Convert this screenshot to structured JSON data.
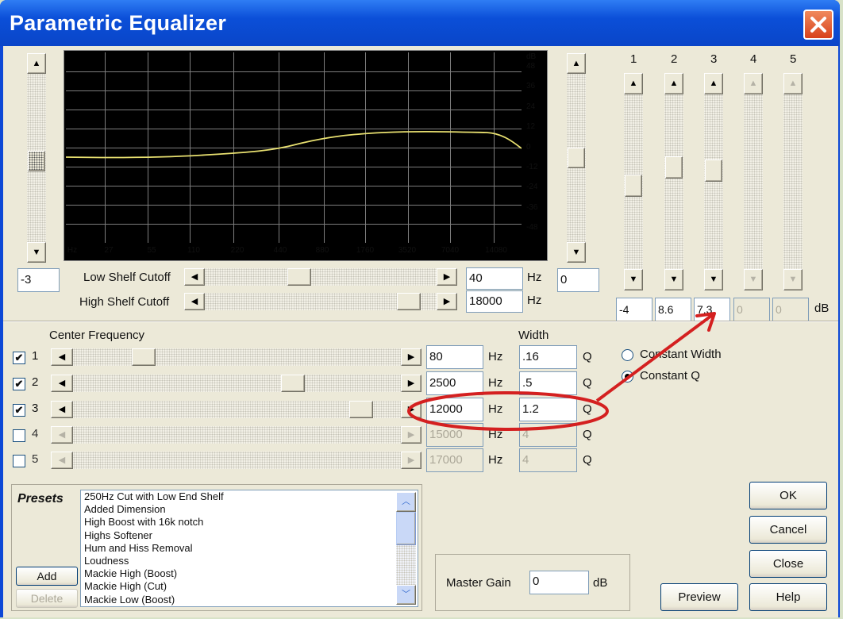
{
  "window": {
    "title": "Parametric Equalizer"
  },
  "graph": {
    "x_ticks": [
      "Hz",
      "27",
      "55",
      "110",
      "220",
      "440",
      "880",
      "1760",
      "3520",
      "7040",
      "14080"
    ],
    "y_unit": "dB",
    "y_ticks": [
      "48",
      "36",
      "24",
      "12",
      "0",
      "-12",
      "-24",
      "-36",
      "-48"
    ],
    "curve_color": "#e8e070"
  },
  "left_gain": {
    "value": "-3"
  },
  "right_gain": {
    "value": "0"
  },
  "shelf": {
    "low_label": "Low Shelf Cutoff",
    "low_value": "40",
    "high_label": "High Shelf Cutoff",
    "high_value": "18000",
    "unit": "Hz"
  },
  "bands": {
    "headers": [
      "1",
      "2",
      "3",
      "4",
      "5"
    ],
    "gains": [
      "-4",
      "8.6",
      "7.3",
      "0",
      "0"
    ],
    "gain_unit": "dB"
  },
  "center": {
    "label": "Center Frequency",
    "width_label": "Width",
    "hz": "Hz",
    "q": "Q",
    "rows": [
      {
        "num": "1",
        "checked": "✔",
        "freq": "80",
        "width": ".16"
      },
      {
        "num": "2",
        "checked": "✔",
        "freq": "2500",
        "width": ".5"
      },
      {
        "num": "3",
        "checked": "✔",
        "freq": "12000",
        "width": "1.2"
      },
      {
        "num": "4",
        "checked": "",
        "freq": "15000",
        "width": "4"
      },
      {
        "num": "5",
        "checked": "",
        "freq": "17000",
        "width": "4"
      }
    ]
  },
  "mode": {
    "constant_width": "Constant Width",
    "constant_q": "Constant Q",
    "selected": "Constant Q"
  },
  "presets": {
    "label": "Presets",
    "items": [
      "250Hz Cut with Low End Shelf",
      "Added Dimension",
      "High Boost with 16k notch",
      "Highs Softener",
      "Hum and Hiss Removal",
      "Loudness",
      "Mackie High (Boost)",
      "Mackie High (Cut)",
      "Mackie Low (Boost)"
    ],
    "add": "Add",
    "delete": "Delete"
  },
  "master_gain": {
    "label": "Master Gain",
    "value": "0",
    "unit": "dB"
  },
  "buttons": {
    "ok": "OK",
    "cancel": "Cancel",
    "close": "Close",
    "preview": "Preview",
    "help": "Help"
  },
  "annotation_color": "#d42020"
}
